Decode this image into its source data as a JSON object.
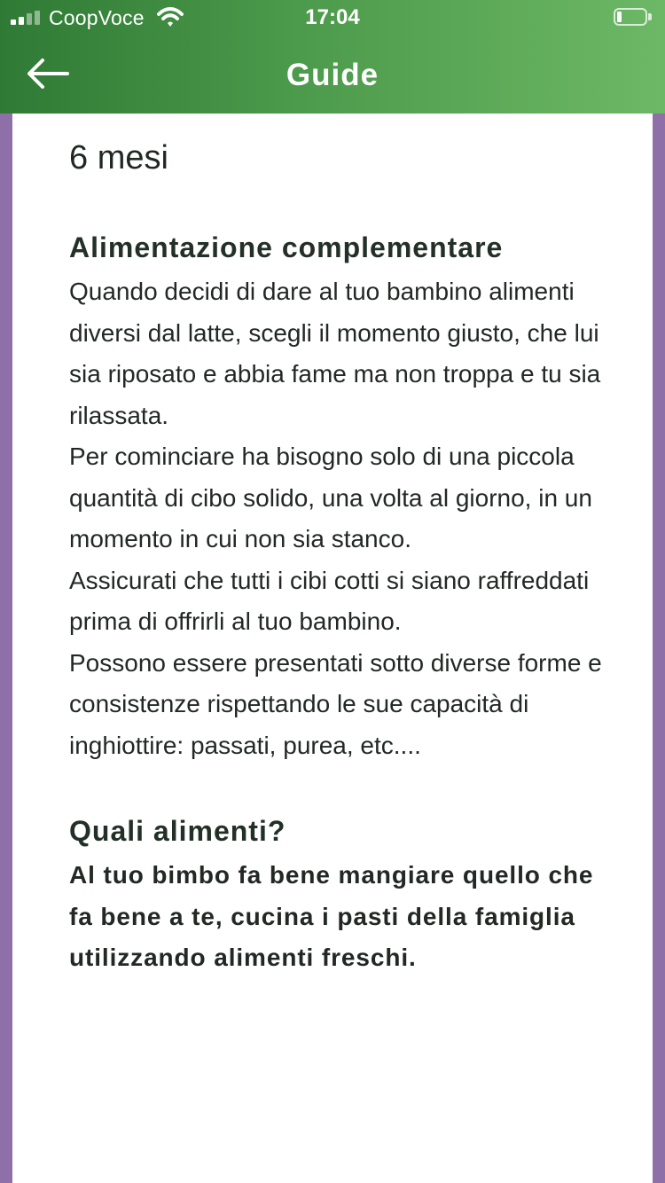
{
  "status_bar": {
    "carrier": "CoopVoce",
    "time": "17:04"
  },
  "nav": {
    "title": "Guide"
  },
  "content": {
    "age_title": "6 mesi",
    "sections": [
      {
        "heading": "Alimentazione complementare",
        "paragraphs": [
          "Quando decidi di dare al tuo bambino alimenti diversi dal latte, scegli il momento giusto, che lui sia riposato e abbia fame ma non troppa e  tu sia rilassata.",
          "Per cominciare ha bisogno solo di una piccola quantità di cibo solido, una volta al giorno, in un momento in cui non sia stanco.",
          "Assicurati che tutti i cibi cotti si siano raffreddati prima di offrirli al tuo bambino.",
          "Possono essere presentati sotto diverse forme e consistenze rispettando le sue capacità di inghiottire: passati, purea, etc...."
        ]
      },
      {
        "heading": "Quali alimenti?",
        "paragraphs": [
          "Al tuo bimbo fa bene mangiare quello che fa bene a te, cucina i pasti della famiglia utilizzando alimenti freschi."
        ]
      }
    ]
  },
  "colors": {
    "header_start": "#2f7a35",
    "header_end": "#6cb866",
    "background_accent": "#8e6fa8",
    "card": "#ffffff",
    "text": "#222824"
  },
  "icons": {
    "back": "arrow-left-icon",
    "wifi": "wifi-icon",
    "battery": "battery-icon",
    "signal": "signal-icon"
  }
}
